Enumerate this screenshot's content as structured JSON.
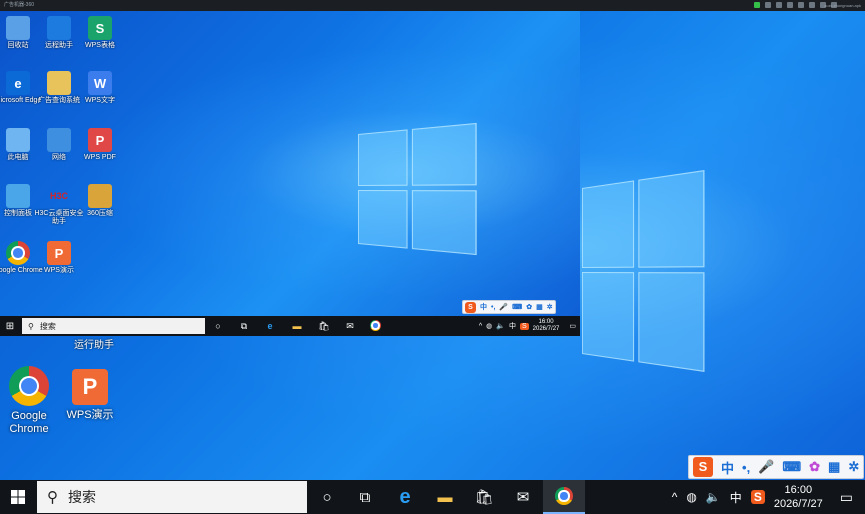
{
  "topbar": {
    "title": "广告机器-360",
    "right_text": "zuzk.zhongnuan.apk"
  },
  "inner_desktop": {
    "icons": [
      {
        "label": "回收站",
        "icon": "recycle-bin-icon",
        "color": "#5aa0e6"
      },
      {
        "label": "远程助手",
        "icon": "remote-assist-icon",
        "color": "#1d7be0"
      },
      {
        "label": "WPS表格",
        "icon": "wps-sheet-icon",
        "color": "#1aa36b",
        "glyph": "S"
      },
      {
        "label": "Microsoft Edge",
        "icon": "edge-icon",
        "color": "#0b6ad6",
        "glyph": "e"
      },
      {
        "label": "广告查询系统",
        "icon": "folder-user-icon",
        "color": "#e8c25a"
      },
      {
        "label": "WPS文字",
        "icon": "wps-writer-icon",
        "color": "#3b7ded",
        "glyph": "W"
      },
      {
        "label": "此电脑",
        "icon": "computer-icon",
        "color": "#6fb5f2"
      },
      {
        "label": "网络",
        "icon": "network-icon",
        "color": "#3f8fe0"
      },
      {
        "label": "WPS PDF",
        "icon": "wps-pdf-icon",
        "color": "#e04848",
        "glyph": "P"
      },
      {
        "label": "控制面板",
        "icon": "control-panel-icon",
        "color": "#4aa6e8"
      },
      {
        "label": "H3C云桌面安全助手",
        "icon": "h3c-icon",
        "color": "#ffffff",
        "glyph": "H3C"
      },
      {
        "label": "360压缩",
        "icon": "zip-icon",
        "color": "#d9a43a"
      },
      {
        "label": "Google Chrome",
        "icon": "chrome-icon",
        "color": "#4285f4"
      },
      {
        "label": "WPS演示",
        "icon": "wps-presentation-icon",
        "color": "#f06a35",
        "glyph": "P"
      }
    ],
    "taskbar": {
      "search_placeholder": "搜索",
      "ime": "中",
      "time": "16:00",
      "date": "2026/7/27"
    }
  },
  "outer_desktop": {
    "partial_label": "运行助手",
    "icons": [
      {
        "label": "Google Chrome",
        "icon": "chrome-icon"
      },
      {
        "label": "WPS演示",
        "icon": "wps-presentation-icon",
        "glyph": "P"
      }
    ],
    "ime_toolbar": {
      "lang": "中",
      "items": [
        "s-logo-icon",
        "lang-icon",
        "punct-icon",
        "mic-icon",
        "keyboard-icon",
        "skin-icon",
        "apps-icon",
        "settings-icon"
      ]
    },
    "taskbar": {
      "search_placeholder": "搜索",
      "ime": "中",
      "time": "16:00",
      "date": "2026/7/27"
    }
  },
  "colors": {
    "accent": "#0c6fe0",
    "taskbar": "#111519",
    "sogou": "#f05a1d"
  }
}
